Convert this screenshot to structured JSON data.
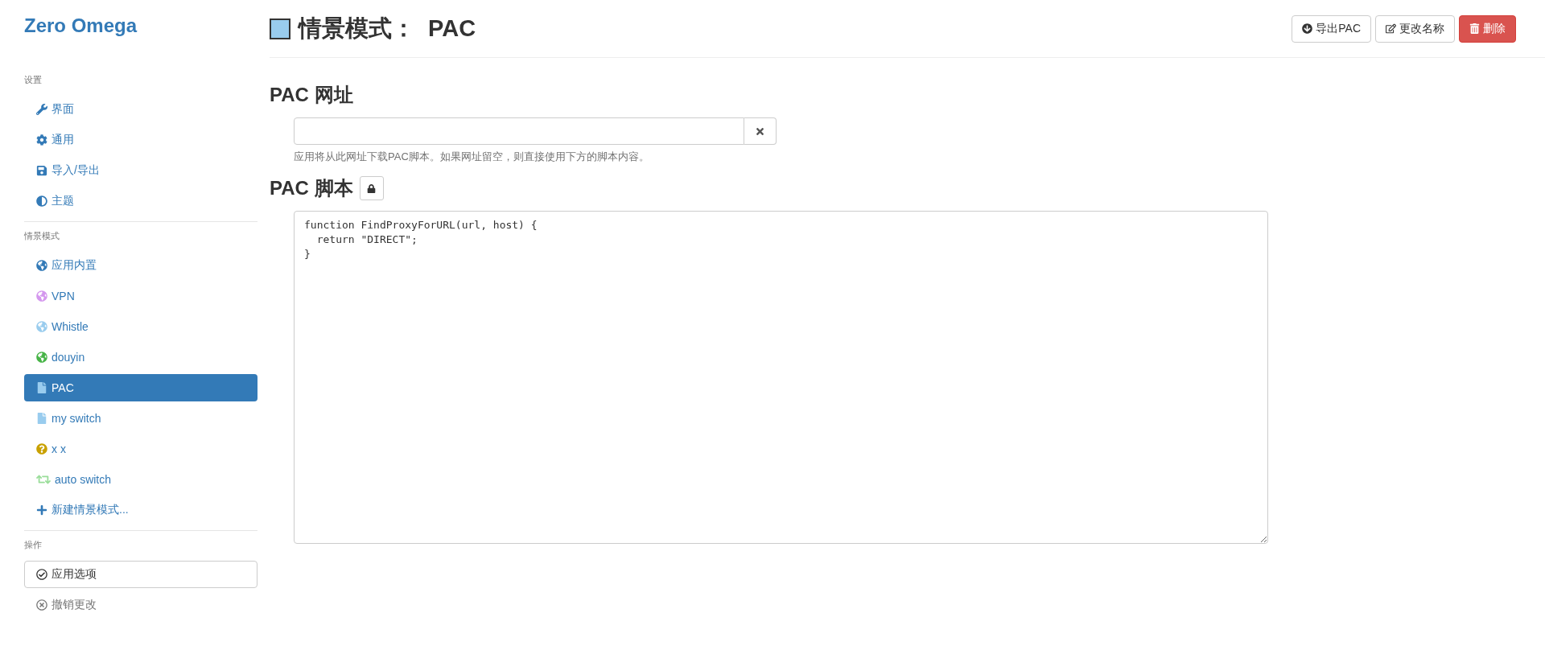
{
  "brand": "Zero Omega",
  "sidebar": {
    "sections": [
      {
        "title": "设置",
        "items": [
          {
            "label": "界面",
            "kind": "wrench",
            "selected": false
          },
          {
            "label": "通用",
            "kind": "gear",
            "selected": false
          },
          {
            "label": "导入/导出",
            "kind": "import",
            "selected": false
          },
          {
            "label": "主题",
            "kind": "contrast",
            "selected": false
          }
        ]
      },
      {
        "title": "情景模式",
        "items": [
          {
            "label": "应用内置",
            "kind": "globe",
            "color": "#337ab7",
            "selected": false
          },
          {
            "label": "VPN",
            "kind": "globe",
            "color": "#d497ee",
            "selected": false
          },
          {
            "label": "Whistle",
            "kind": "globe",
            "color": "#99ccee",
            "selected": false
          },
          {
            "label": "douyin",
            "kind": "globe",
            "color": "#47b447",
            "selected": false
          },
          {
            "label": "PAC",
            "kind": "file",
            "color": "#99ccee",
            "selected": true
          },
          {
            "label": "my switch",
            "kind": "file",
            "color": "#99ccee",
            "selected": false
          },
          {
            "label": "x x",
            "kind": "question",
            "color": "#c9a100",
            "selected": false
          },
          {
            "label": "auto switch",
            "kind": "switch",
            "color": "#99dd99",
            "selected": false
          },
          {
            "label": "新建情景模式...",
            "kind": "plus",
            "color": "#337ab7",
            "selected": false
          }
        ]
      },
      {
        "title": "操作",
        "items": [
          {
            "label": "应用选项",
            "kind": "apply",
            "selected": false
          },
          {
            "label": "撤销更改",
            "kind": "discard",
            "selected": false
          }
        ]
      }
    ]
  },
  "header": {
    "color": "#99ccee",
    "title": "情景模式：  PAC",
    "buttons": [
      {
        "label": "导出PAC",
        "kind": "export"
      },
      {
        "label": "更改名称",
        "kind": "rename"
      },
      {
        "label": "删除",
        "kind": "delete"
      }
    ]
  },
  "pac_url": {
    "heading": "PAC 网址",
    "help": "应用将从此网址下载PAC脚本。如果网址留空，则直接使用下方的脚本内容。"
  },
  "pac_script": {
    "heading": "PAC 脚本",
    "code": "function FindProxyForURL(url, host) {\n  return \"DIRECT\";\n}"
  }
}
